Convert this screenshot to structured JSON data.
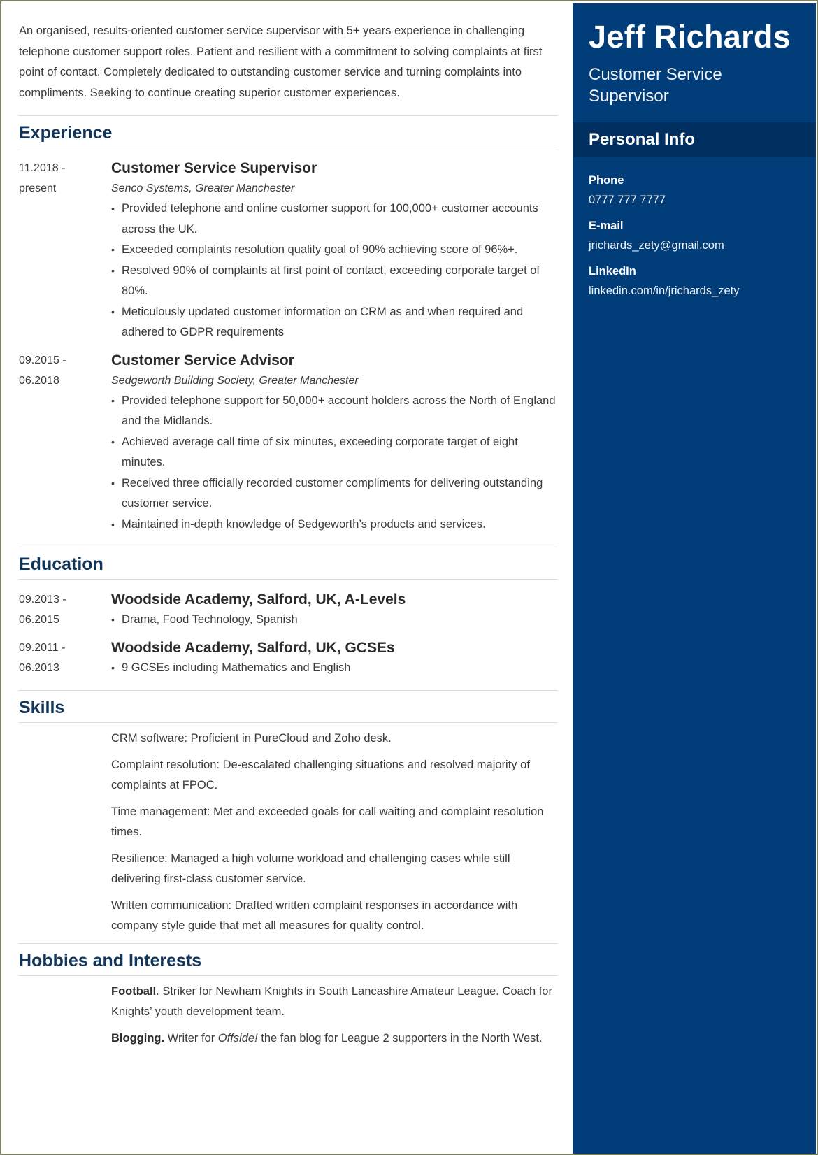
{
  "summary": "An organised, results-oriented customer service supervisor with 5+ years experience in challenging telephone customer support roles. Patient and resilient with a commitment to solving complaints at first point of contact. Completely dedicated to outstanding customer service and turning complaints into compliments. Seeking to continue creating superior customer experiences.",
  "sidebar": {
    "name": "Jeff Richards",
    "role": "Customer Service Supervisor",
    "personal_info_title": "Personal Info",
    "phone_label": "Phone",
    "phone": "0777 777 7777",
    "email_label": "E-mail",
    "email": "jrichards_zety@gmail.com",
    "linkedin_label": "LinkedIn",
    "linkedin": "linkedin.com/in/jrichards_zety"
  },
  "experience": {
    "title": "Experience",
    "jobs": [
      {
        "date_start": "11.2018 -",
        "date_end": "present",
        "title": "Customer Service Supervisor",
        "company": "Senco Systems, Greater Manchester",
        "bullets": [
          "Provided telephone and online customer support for 100,000+ customer accounts across the UK.",
          "Exceeded complaints resolution quality goal of 90% achieving score of 96%+.",
          "Resolved 90% of complaints at first point of contact, exceeding corporate target of 80%.",
          "Meticulously updated customer information on CRM as and when required and adhered to GDPR requirements"
        ]
      },
      {
        "date_start": "09.2015 -",
        "date_end": "06.2018",
        "title": "Customer Service Advisor",
        "company": "Sedgeworth Building Society, Greater Manchester",
        "bullets": [
          "Provided telephone support for 50,000+ account holders across the North of England and the Midlands.",
          "Achieved average call time of six minutes, exceeding corporate target of eight minutes.",
          "Received three officially recorded customer compliments for delivering outstanding customer service.",
          "Maintained in-depth knowledge of Sedgeworth’s products and services."
        ]
      }
    ]
  },
  "education": {
    "title": "Education",
    "items": [
      {
        "date_start": "09.2013 -",
        "date_end": "06.2015",
        "title": "Woodside Academy, Salford, UK, A-Levels",
        "bullets": [
          "Drama, Food Technology, Spanish"
        ]
      },
      {
        "date_start": "09.2011 -",
        "date_end": "06.2013",
        "title": "Woodside Academy, Salford, UK, GCSEs",
        "bullets": [
          "9 GCSEs including Mathematics and English"
        ]
      }
    ]
  },
  "skills": {
    "title": "Skills",
    "items": [
      "CRM software: Proficient in PureCloud and Zoho desk.",
      "Complaint resolution: De-escalated challenging situations and resolved majority of complaints at FPOC.",
      "Time management: Met and exceeded goals for call waiting and complaint resolution times.",
      "Resilience: Managed a high volume workload and challenging cases while still delivering first-class customer service.",
      "Written communication: Drafted written complaint responses in accordance with company style guide that met all measures for quality control."
    ]
  },
  "hobbies": {
    "title": "Hobbies and Interests",
    "items": [
      {
        "name": "Football",
        "sep": ". ",
        "text_before": "Striker for Newham Knights in South Lancashire Amateur League. Coach for Knights’ youth development team.",
        "italic": "",
        "text_after": ""
      },
      {
        "name": "Blogging.",
        "sep": " ",
        "text_before": "Writer for ",
        "italic": "Offside!",
        "text_after": " the fan blog for League 2 supporters in the North West."
      }
    ]
  },
  "colors": {
    "sidebar_bg": "#003d79",
    "sidebar_band": "#002f60",
    "heading": "#12355b",
    "border": "#7d8166"
  }
}
